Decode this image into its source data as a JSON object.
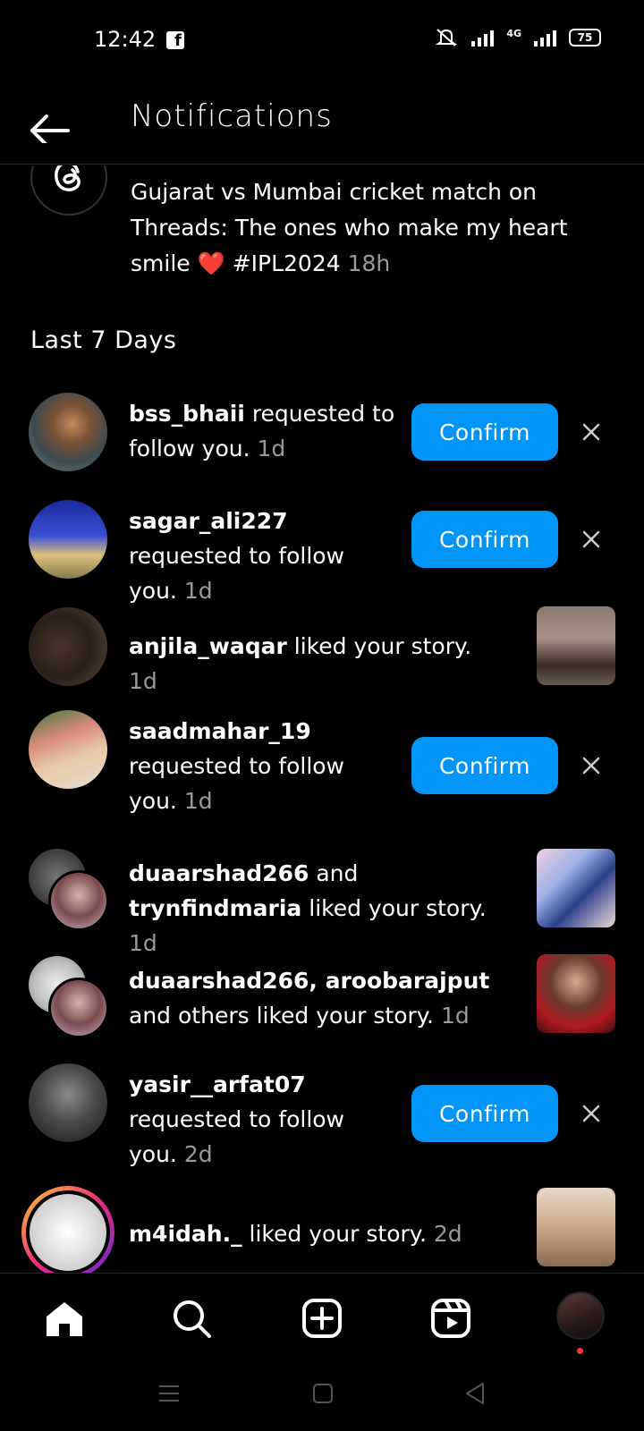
{
  "status_bar": {
    "time": "12:42",
    "network": "4G",
    "battery": "75",
    "icons": [
      "facebook-icon",
      "mute-icon",
      "signal-icon",
      "battery-icon"
    ]
  },
  "header": {
    "title": "Notifications",
    "back_icon": "arrow-left-icon"
  },
  "threads_notif": {
    "text": "Gujarat vs Mumbai cricket match on Threads: The ones who make my heart smile",
    "heart": "❤️",
    "hashtag": "#IPL2024",
    "time": "18h"
  },
  "section": {
    "title": "Last 7 Days"
  },
  "notifications": [
    {
      "user": "bss_bhaii",
      "action": "requested to follow you.",
      "time": "1d",
      "button": "Confirm"
    },
    {
      "user": "sagar_ali227",
      "action": "requested to follow you.",
      "time": "1d",
      "button": "Confirm"
    },
    {
      "user": "anjila_waqar",
      "action": "liked your story.",
      "time": "1d"
    },
    {
      "user": "saadmahar_19",
      "action": "requested to follow you.",
      "time": "1d",
      "button": "Confirm"
    },
    {
      "user": "duaarshad266",
      "connector": "and",
      "user2": "trynfindmaria",
      "action": "liked your story.",
      "time": "1d"
    },
    {
      "user": "duaarshad266, aroobarajput",
      "connector": "and",
      "action": "others liked your story.",
      "time": "1d"
    },
    {
      "user": "yasir__arfat07",
      "action": "requested to follow you.",
      "time": "2d",
      "button": "Confirm"
    },
    {
      "user": "m4idah._",
      "action": "liked your story.",
      "time": "2d"
    }
  ],
  "bottom_nav": {
    "items": [
      "home-icon",
      "search-icon",
      "create-icon",
      "reels-icon",
      "profile-avatar"
    ]
  },
  "colors": {
    "background": "#000000",
    "accent": "#0095f6",
    "muted_text": "#9a9a9a",
    "notification_dot": "#ff3040"
  }
}
